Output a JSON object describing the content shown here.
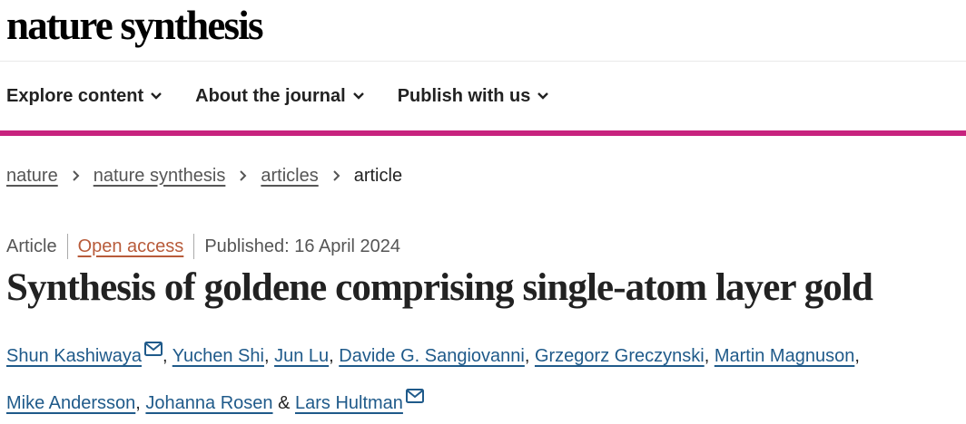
{
  "header": {
    "logo": "nature synthesis"
  },
  "nav": {
    "items": [
      {
        "label": "Explore content",
        "icon": "chevron-down-icon"
      },
      {
        "label": "About the journal",
        "icon": "chevron-down-icon"
      },
      {
        "label": "Publish with us",
        "icon": "chevron-down-icon"
      }
    ]
  },
  "breadcrumb": {
    "items": [
      "nature",
      "nature synthesis",
      "articles"
    ],
    "current": "article"
  },
  "article": {
    "type": "Article",
    "access": "Open access",
    "published": "Published: 16 April 2024",
    "title": "Synthesis of goldene comprising single-atom layer gold",
    "authors": [
      {
        "name": "Shun Kashiwaya",
        "mail": true,
        "sep": ", "
      },
      {
        "name": "Yuchen Shi",
        "mail": false,
        "sep": ", "
      },
      {
        "name": "Jun Lu",
        "mail": false,
        "sep": ", "
      },
      {
        "name": "Davide G. Sangiovanni",
        "mail": false,
        "sep": ", "
      },
      {
        "name": "Grzegorz Greczynski",
        "mail": false,
        "sep": ", "
      },
      {
        "name": "Martin Magnuson",
        "mail": false,
        "sep": ", "
      },
      {
        "name": "Mike Andersson",
        "mail": false,
        "sep": ", "
      },
      {
        "name": "Johanna Rosen",
        "mail": false,
        "sep": " & "
      },
      {
        "name": "Lars Hultman",
        "mail": true,
        "sep": ""
      }
    ]
  },
  "colors": {
    "accent_bar": "#c7237e",
    "open_access": "#b85b3a",
    "author_link": "#1f5a8a"
  }
}
